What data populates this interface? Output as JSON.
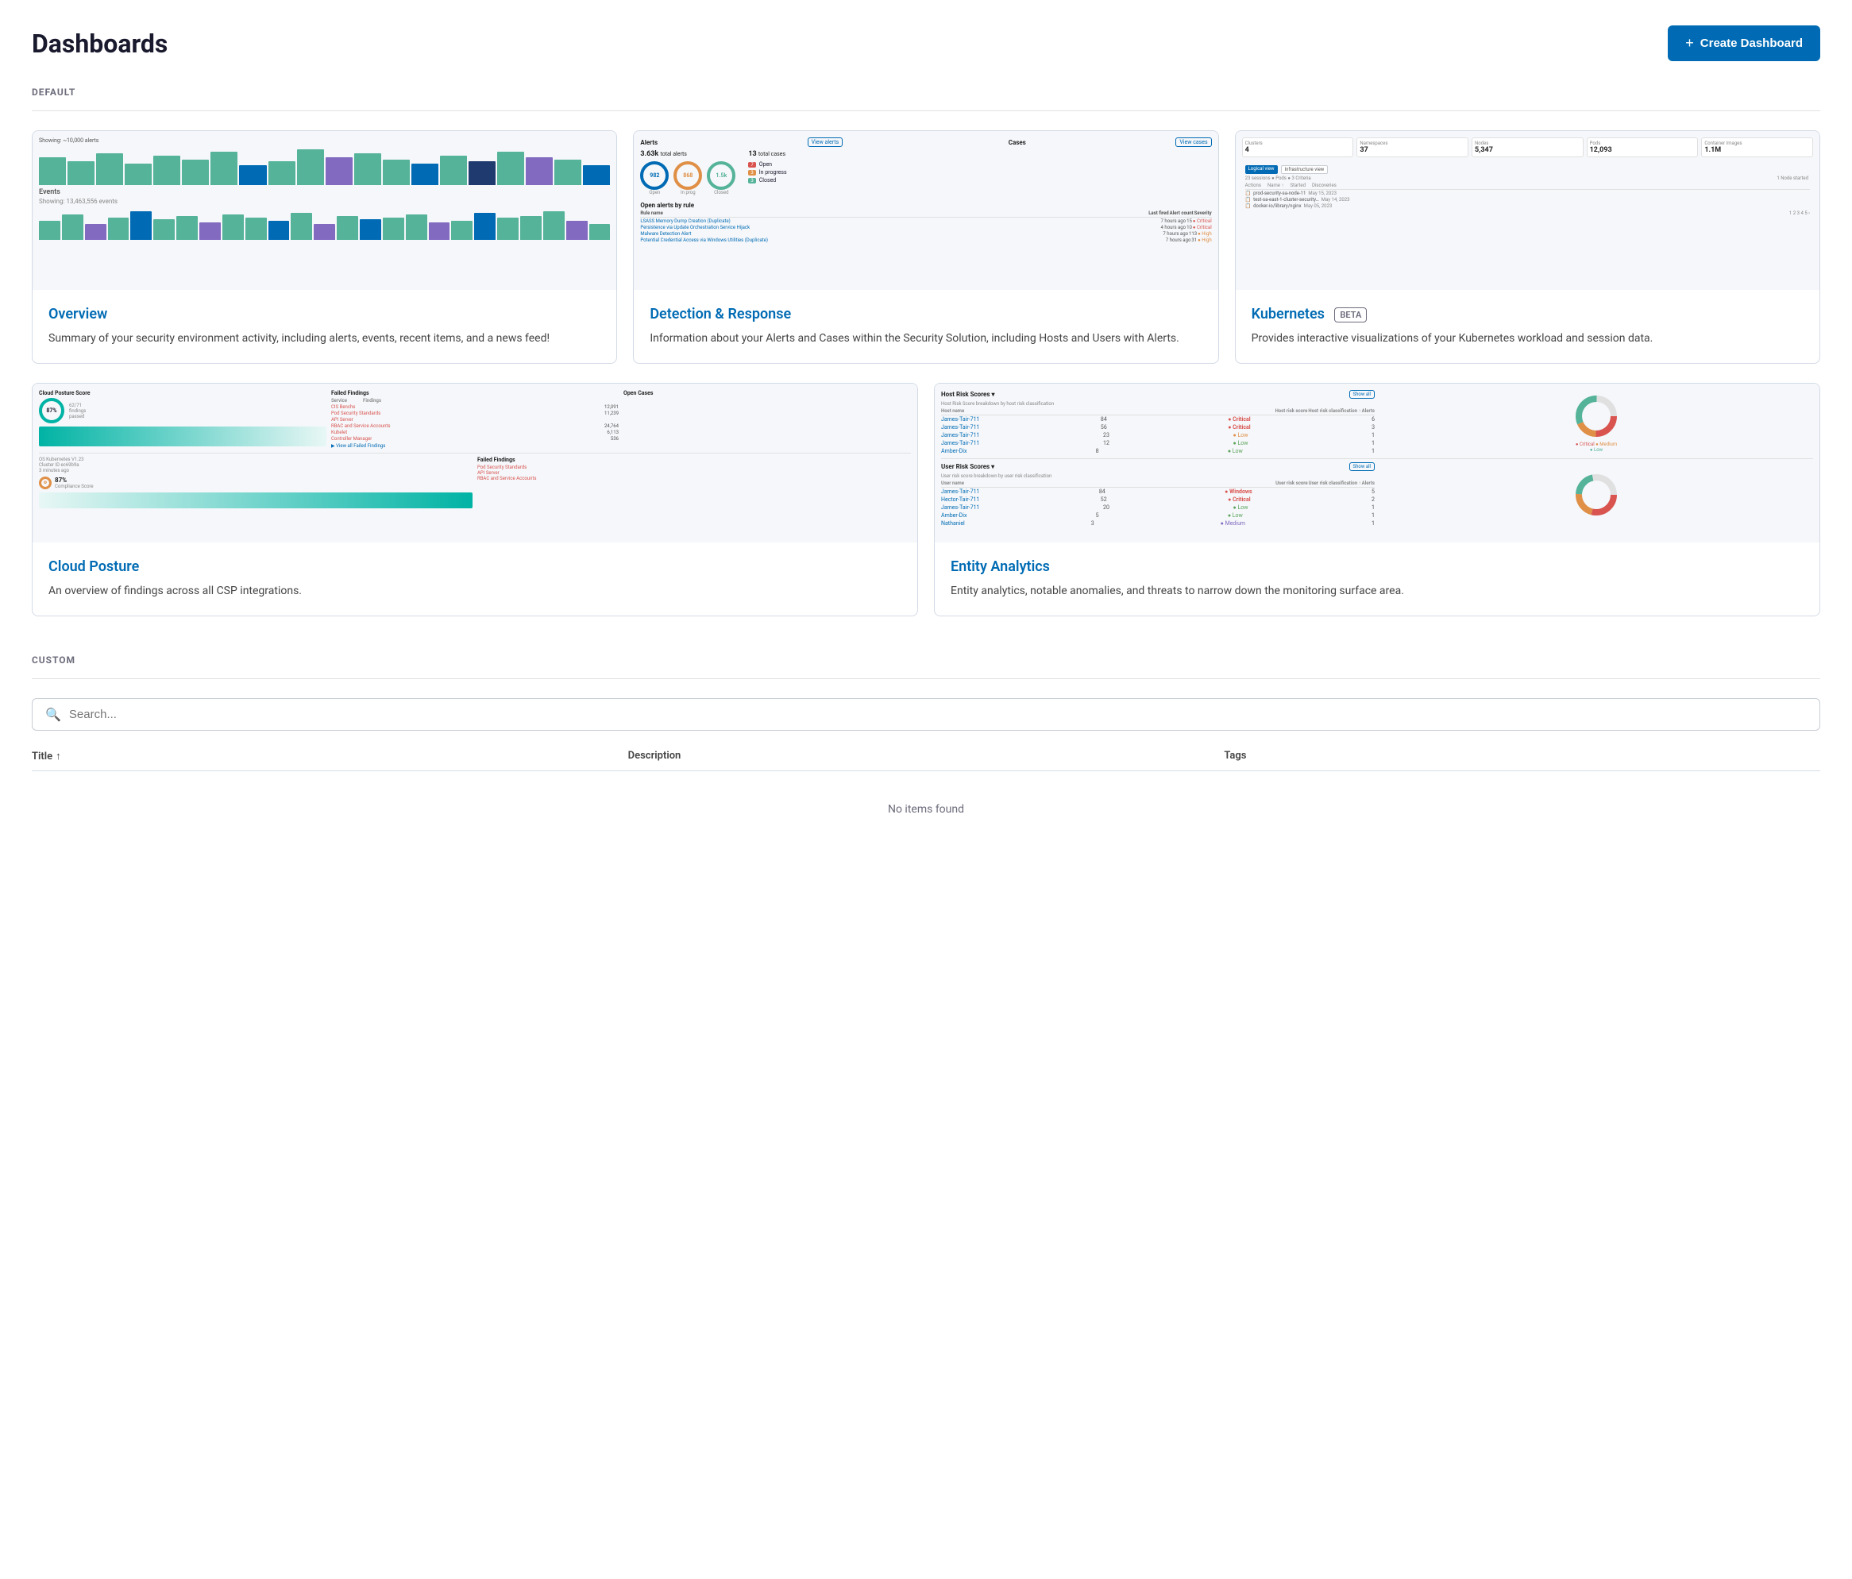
{
  "page": {
    "title": "Dashboards"
  },
  "header": {
    "create_button": "Create Dashboard",
    "create_icon": "+"
  },
  "default_section": {
    "label": "DEFAULT"
  },
  "custom_section": {
    "label": "CUSTOM",
    "search_placeholder": "Search...",
    "table_col_title": "Title",
    "table_col_title_sort": "↑",
    "table_col_description": "Description",
    "table_col_tags": "Tags",
    "no_items_text": "No items found"
  },
  "cards": [
    {
      "id": "overview",
      "title": "Overview",
      "badge": null,
      "description": "Summary of your security environment activity, including alerts, events, recent items, and a news feed!"
    },
    {
      "id": "detection-response",
      "title": "Detection & Response",
      "badge": null,
      "description": "Information about your Alerts and Cases within the Security Solution, including Hosts and Users with Alerts."
    },
    {
      "id": "kubernetes",
      "title": "Kubernetes",
      "badge": "BETA",
      "description": "Provides interactive visualizations of your Kubernetes workload and session data."
    },
    {
      "id": "cloud-posture",
      "title": "Cloud Posture",
      "badge": null,
      "description": "An overview of findings across all CSP integrations."
    },
    {
      "id": "entity-analytics",
      "title": "Entity Analytics",
      "badge": null,
      "description": "Entity analytics, notable anomalies, and threats to narrow down the monitoring surface area."
    }
  ],
  "colors": {
    "blue": "#006bb4",
    "green": "#54b399",
    "teal": "#00b3a4",
    "red": "#d9534f",
    "orange": "#e08f46",
    "purple": "#826ac0",
    "navy": "#1f3a6e",
    "lightblue": "#6dccb1",
    "bar1": "#54b399",
    "bar2": "#006bb4",
    "bar3": "#826ac0"
  }
}
